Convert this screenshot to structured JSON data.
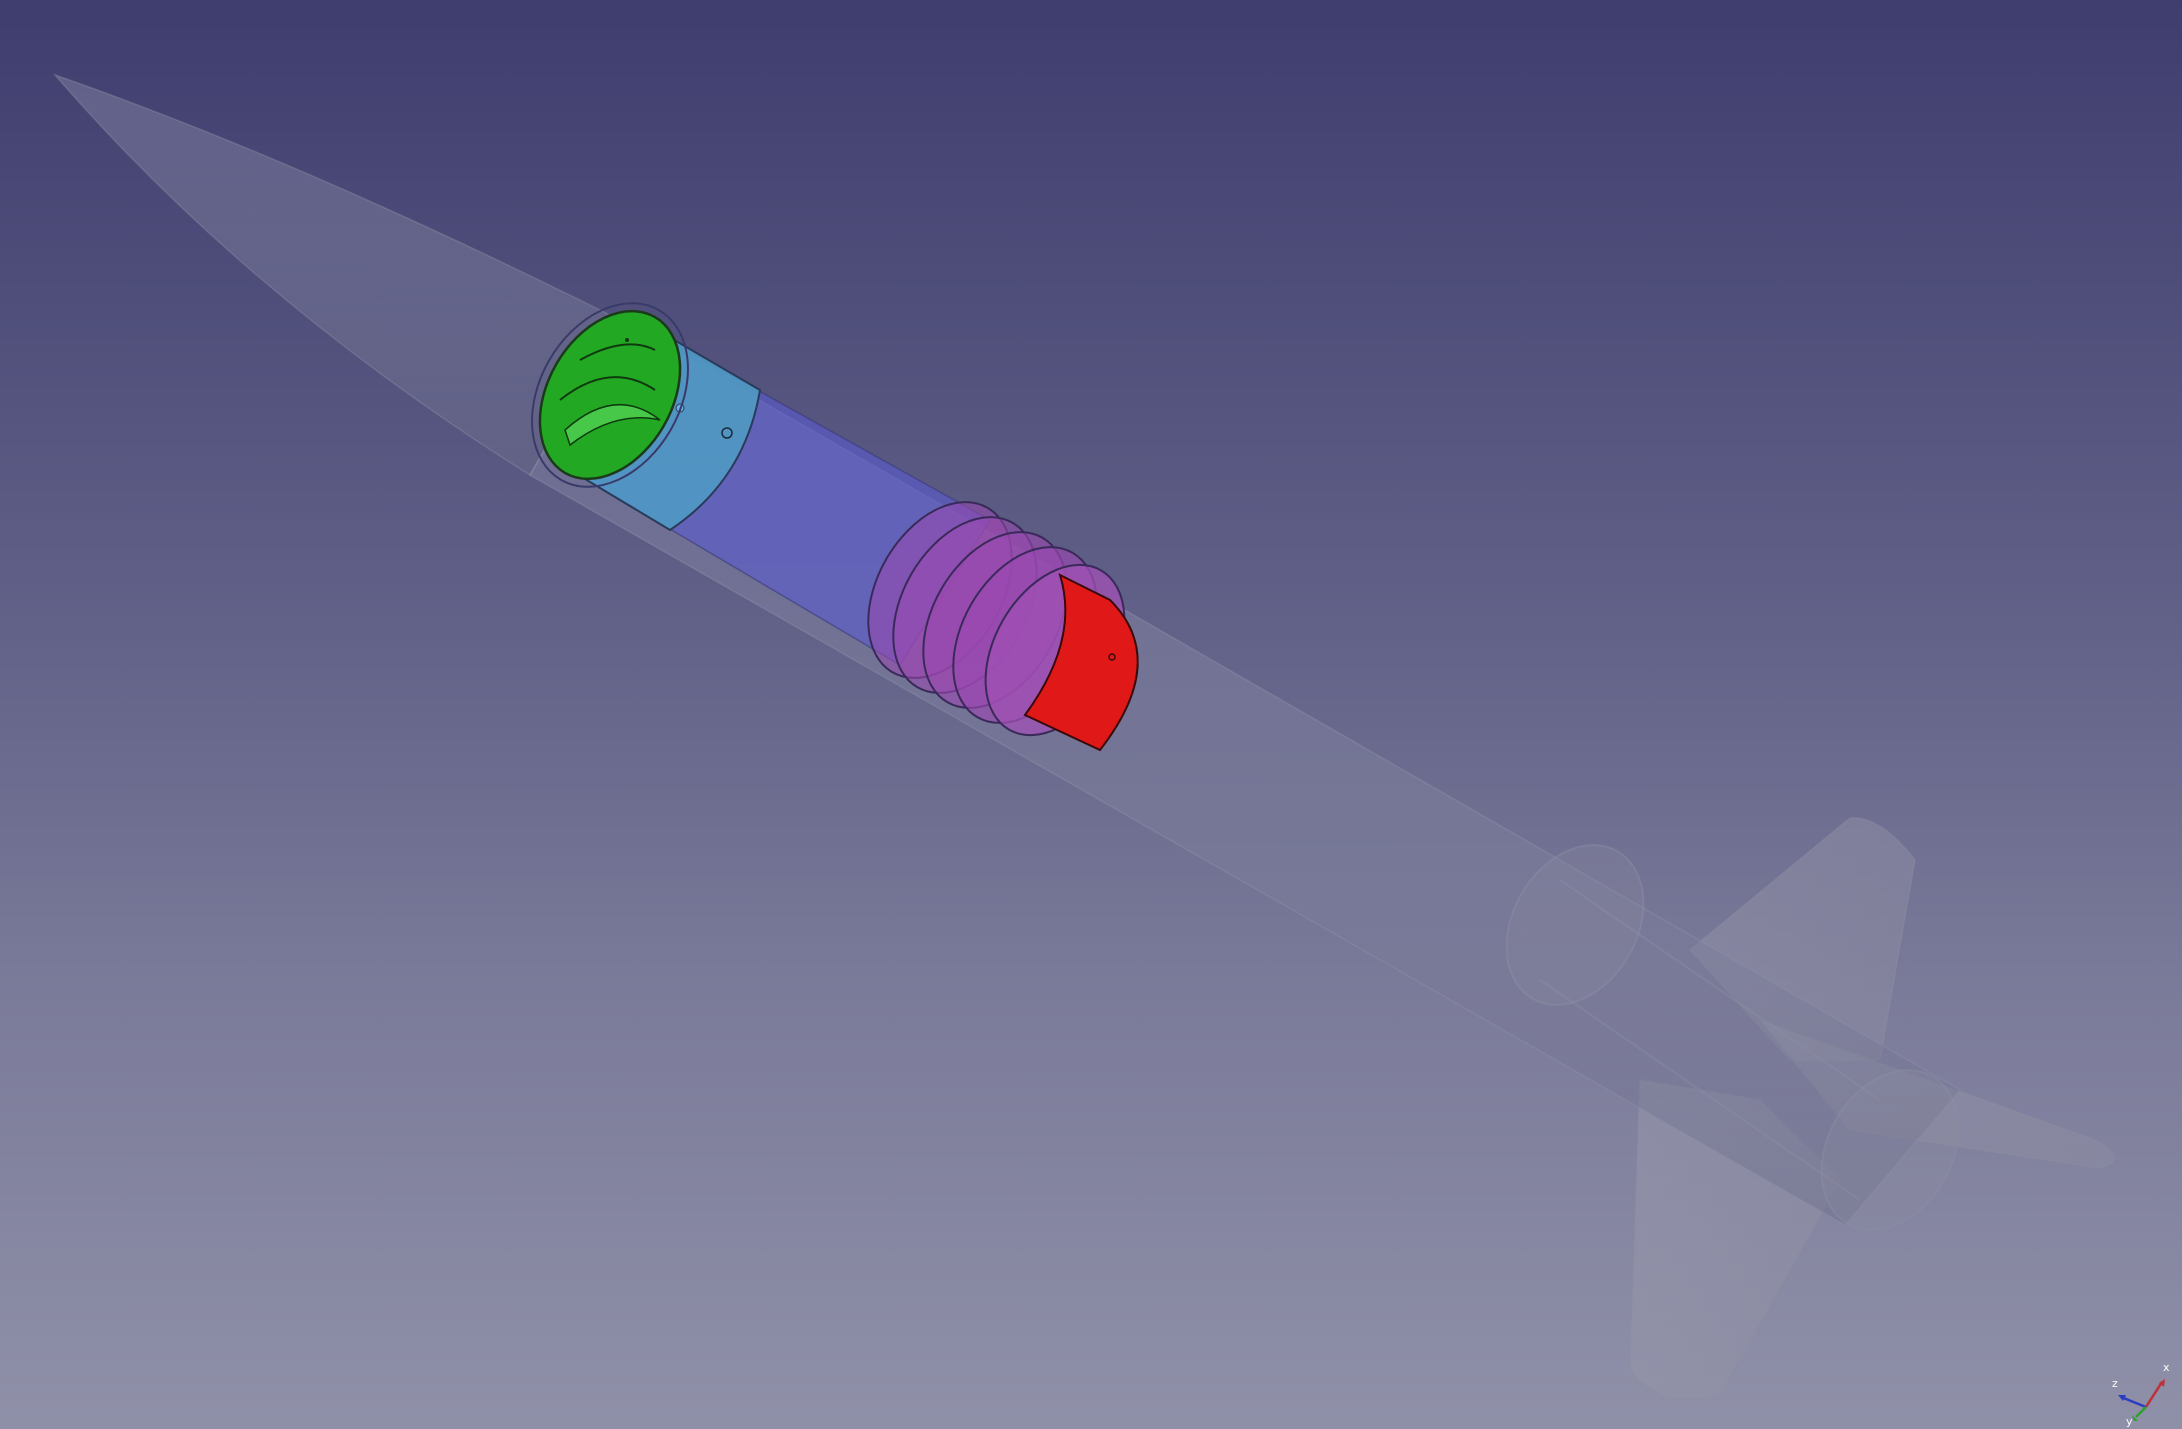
{
  "app": {
    "view": "3D viewport"
  },
  "scene": {
    "background_top": "#3f3d6e",
    "background_bottom": "#8f90a8",
    "parts": [
      {
        "name": "nose-cone",
        "color": "#8a8ca6"
      },
      {
        "name": "body-tube",
        "color": "#8a8ca6"
      },
      {
        "name": "avionics-bay",
        "color": "#5a5ad0"
      },
      {
        "name": "bulkhead-green",
        "color": "#22a822"
      },
      {
        "name": "coupler-cyan",
        "color": "#4f9ec4"
      },
      {
        "name": "ring-red",
        "color": "#e01818"
      },
      {
        "name": "rings-purple",
        "color": "#9b48b0"
      },
      {
        "name": "fins",
        "color": "#9a9aa8"
      }
    ]
  },
  "axis_triad": {
    "x_label": "x",
    "y_label": "y",
    "z_label": "z",
    "x_color": "#c0303a",
    "y_color": "#2ea02e",
    "z_color": "#2a3cc0"
  }
}
